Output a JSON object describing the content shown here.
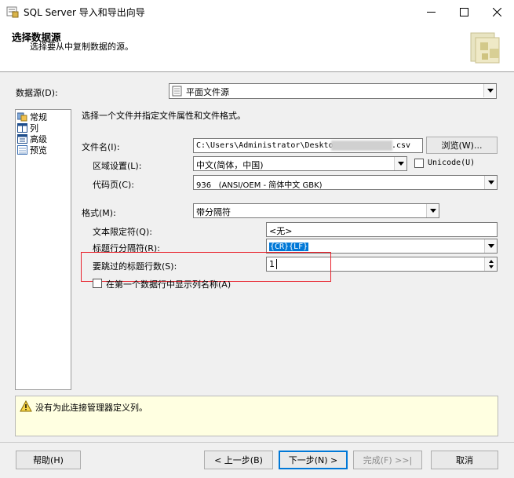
{
  "window": {
    "title": "SQL Server 导入和导出向导"
  },
  "header": {
    "title": "选择数据源",
    "subtitle": "选择要从中复制数据的源。"
  },
  "datasource": {
    "label": "数据源(D):",
    "value": "平面文件源"
  },
  "nav": {
    "items": [
      {
        "label": "常规"
      },
      {
        "label": "列"
      },
      {
        "label": "高级"
      },
      {
        "label": "预览"
      }
    ]
  },
  "general": {
    "description": "选择一个文件并指定文件属性和文件格式。",
    "filename_label": "文件名(I):",
    "filename_value": "C:\\Users\\Administrator\\Desktop",
    "filename_suffix": ".csv",
    "browse_label": "浏览(W)...",
    "locale_label": "区域设置(L):",
    "locale_value": "中文(简体，中国)",
    "unicode_label": "Unicode(U)",
    "codepage_label": "代码页(C):",
    "codepage_value": "936   (ANSI/OEM - 简体中文 GBK)",
    "format_label": "格式(M):",
    "format_value": "带分隔符",
    "text_qualifier_label": "文本限定符(Q):",
    "text_qualifier_value": "<无>",
    "header_delim_label": "标题行分隔符(R):",
    "header_delim_value": "{CR}{LF}",
    "skip_rows_label": "要跳过的标题行数(S):",
    "skip_rows_value": "1",
    "first_row_names_label": "在第一个数据行中显示列名称(A)"
  },
  "message": {
    "text": "没有为此连接管理器定义列。"
  },
  "footer": {
    "help": "帮助(H)",
    "back": "< 上一步(B)",
    "next": "下一步(N) >",
    "finish": "完成(F) >>|",
    "cancel": "取消"
  },
  "colors": {
    "highlight_red": "#e8232d",
    "message_bg": "#ffffe1",
    "selection_blue": "#0078d7"
  }
}
